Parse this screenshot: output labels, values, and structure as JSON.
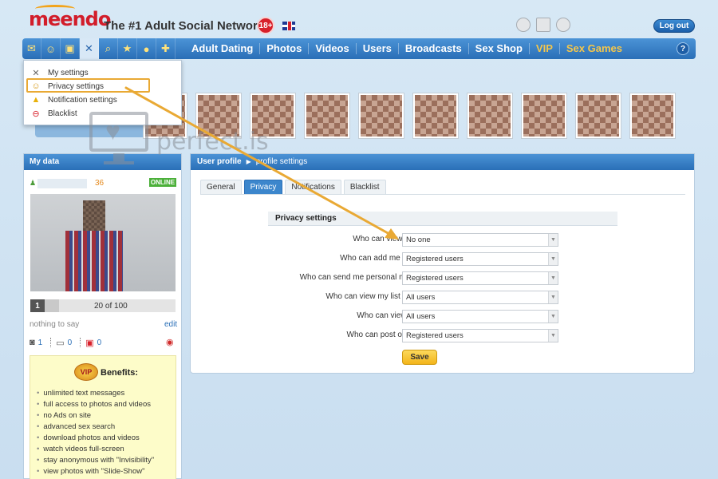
{
  "header": {
    "logo": "meendo",
    "tagline": "The #1 Adult Social Network",
    "age_badge": "18+",
    "logout_label": "Log out"
  },
  "nav": {
    "icons": [
      "mail-icon",
      "users-icon",
      "gift-icon",
      "settings-icon",
      "search-icon",
      "star-icon",
      "coins-icon",
      "present-icon"
    ],
    "links": [
      {
        "label": "Adult Dating",
        "gold": false
      },
      {
        "label": "Photos",
        "gold": false
      },
      {
        "label": "Videos",
        "gold": false
      },
      {
        "label": "Users",
        "gold": false
      },
      {
        "label": "Broadcasts",
        "gold": false
      },
      {
        "label": "Sex Shop",
        "gold": false
      },
      {
        "label": "VIP",
        "gold": true
      },
      {
        "label": "Sex Games",
        "gold": true
      }
    ],
    "help_label": "?"
  },
  "dropdown": {
    "items": [
      {
        "label": "My settings",
        "icon": "settings-icon"
      },
      {
        "label": "Privacy settings",
        "icon": "privacy-icon"
      },
      {
        "label": "Notification settings",
        "icon": "warning-icon"
      },
      {
        "label": "Blacklist",
        "icon": "blacklist-icon"
      }
    ]
  },
  "watermark": {
    "text": "perfect.is"
  },
  "left_panel": {
    "title": "My data",
    "age": "36",
    "online": "ONLINE",
    "progress_step": "1",
    "progress_text": "20 of 100",
    "progress_fraction": 0.2,
    "status": "nothing to say",
    "edit_label": "edit",
    "stats": [
      {
        "icon": "camera-icon",
        "value": "1"
      },
      {
        "icon": "video-icon",
        "value": "0"
      },
      {
        "icon": "gift-icon",
        "value": "0"
      }
    ],
    "vip": {
      "badge": "VIP",
      "title": "Benefits:",
      "benefits": [
        "unlimited text messages",
        "full access to photos and videos",
        "no Ads on site",
        "advanced sex search",
        "download photos and videos",
        "watch videos full-screen",
        "stay anonymous with \"Invisibility\"",
        "view photos with \"Slide-Show\""
      ]
    }
  },
  "right_panel": {
    "breadcrumb": [
      "User profile",
      "profile settings"
    ],
    "tabs": [
      {
        "label": "General",
        "active": false
      },
      {
        "label": "Privacy",
        "active": true
      },
      {
        "label": "Notifications",
        "active": false
      },
      {
        "label": "Blacklist",
        "active": false
      }
    ],
    "section_title": "Privacy settings",
    "rows": [
      {
        "label": "Who can view my page?:",
        "value": "No one"
      },
      {
        "label": "Who can add me to friends?:",
        "value": "Registered users"
      },
      {
        "label": "Who can send me personal messages?:",
        "value": "Registered users"
      },
      {
        "label": "Who can view my list of friends?:",
        "value": "All users"
      },
      {
        "label": "Who can view my wall?:",
        "value": "All users"
      },
      {
        "label": "Who can post on my wall?:",
        "value": "Registered users"
      }
    ],
    "save_label": "Save"
  },
  "colors": {
    "brand_blue": "#2a6fb7",
    "brand_red": "#d21d2a",
    "annotation_orange": "#e9a934",
    "save_yellow": "#f3b51a"
  }
}
